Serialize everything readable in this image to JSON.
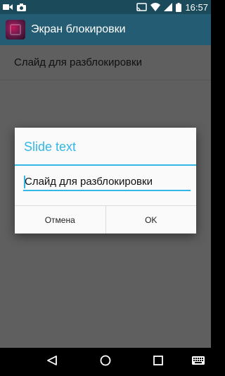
{
  "status_bar": {
    "time": "16:57",
    "icons": [
      "video-icon",
      "camera-icon",
      "cast-icon",
      "wifi-icon",
      "signal-icon",
      "battery-icon"
    ]
  },
  "app_bar": {
    "title": "Экран блокировки"
  },
  "preference": {
    "title": "Слайд для разблокировки"
  },
  "dialog": {
    "title": "Slide text",
    "input_value": "Слайд для разблокировки",
    "cancel_label": "Отмена",
    "ok_label": "OK"
  },
  "nav_bar": {
    "icons": [
      "back-icon",
      "home-icon",
      "recents-icon",
      "keyboard-icon"
    ]
  },
  "colors": {
    "accent": "#32b7e7",
    "app_bar": "#245d73",
    "status_bar": "#1b4a5a",
    "dim_background": "#5f5f5f"
  }
}
